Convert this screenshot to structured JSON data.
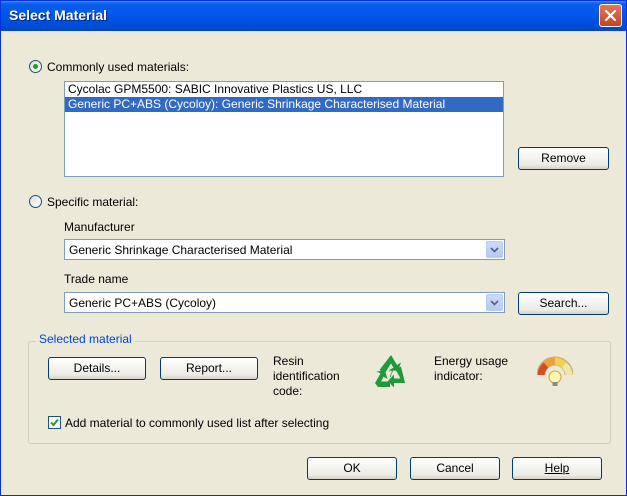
{
  "window": {
    "title": "Select Material"
  },
  "common": {
    "radio_label": "Commonly used materials:",
    "selected": true,
    "items": [
      "Cycolac GPM5500: SABIC Innovative Plastics US, LLC",
      "Generic PC+ABS (Cycoloy): Generic Shrinkage Characterised Material"
    ],
    "selected_index": 1,
    "remove_label": "Remove"
  },
  "specific": {
    "radio_label": "Specific material:",
    "selected": false,
    "manufacturer_label": "Manufacturer",
    "manufacturer_value": "Generic Shrinkage Characterised Material",
    "trade_name_label": "Trade name",
    "trade_name_value": "Generic PC+ABS (Cycoloy)",
    "search_label": "Search..."
  },
  "selected_material": {
    "group_title": "Selected material",
    "details_label": "Details...",
    "report_label": "Report...",
    "resin_label": "Resin identification code:",
    "resin_code": "7",
    "energy_label": "Energy usage indicator:",
    "add_to_list_label": "Add material to commonly used list after selecting",
    "add_to_list_checked": true
  },
  "footer": {
    "ok_label": "OK",
    "cancel_label": "Cancel",
    "help_label": "Help"
  },
  "icons": {
    "close": "close-icon",
    "dropdown": "chevron-down-icon",
    "recycle": "recycle-icon",
    "energy": "energy-gauge-icon",
    "check": "checkmark-icon"
  },
  "colors": {
    "title_bar": "#0058ee",
    "selection": "#316ac5",
    "group_title": "#0046d5",
    "recycle_green": "#1f9a3a"
  }
}
